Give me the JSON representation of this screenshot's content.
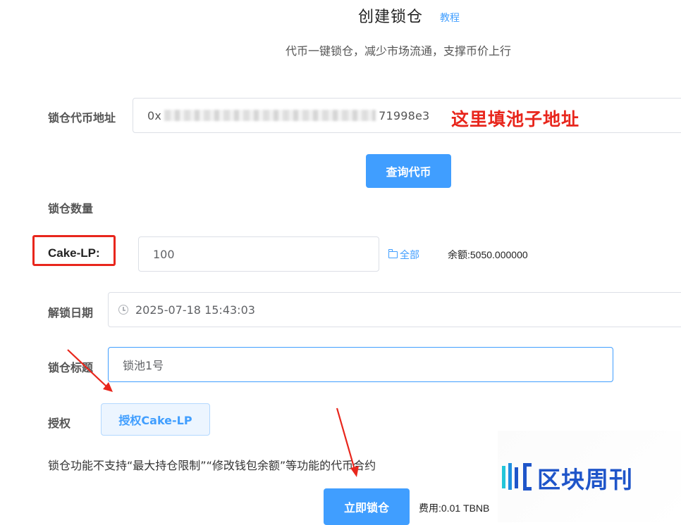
{
  "header": {
    "title": "创建锁仓",
    "tutorial_link": "教程",
    "subtitle": "代币一键锁仓，减少市场流通，支撑币价上行"
  },
  "form": {
    "token_address": {
      "label": "锁仓代币地址",
      "value_prefix": "0x",
      "value_suffix": "71998e3",
      "annotation": "这里填池子地址"
    },
    "query_button": "查询代币",
    "lock_amount": {
      "section_label": "锁仓数量",
      "token_name": "Cake-LP:",
      "value": "100",
      "all_button": "全部",
      "balance": "余额:5050.000000"
    },
    "unlock_date": {
      "label": "解锁日期",
      "value": "2025-07-18 15:43:03"
    },
    "lock_title": {
      "label": "锁仓标题",
      "value": "锁池1号"
    },
    "authorize": {
      "label": "授权",
      "button": "授权Cake-LP"
    },
    "notice": "锁仓功能不支持“最大持仓限制”“修改钱包余额”等功能的代币合约",
    "lock_button": "立即锁仓",
    "fee": "费用:0.01 TBNB"
  },
  "watermark": {
    "text": "区块周刊"
  },
  "colors": {
    "primary": "#409eff",
    "annotation_red": "#e8261c",
    "watermark_blue": "#1f55c9"
  },
  "icons": [
    "folder-icon",
    "clock-icon",
    "arrow-annotation"
  ]
}
